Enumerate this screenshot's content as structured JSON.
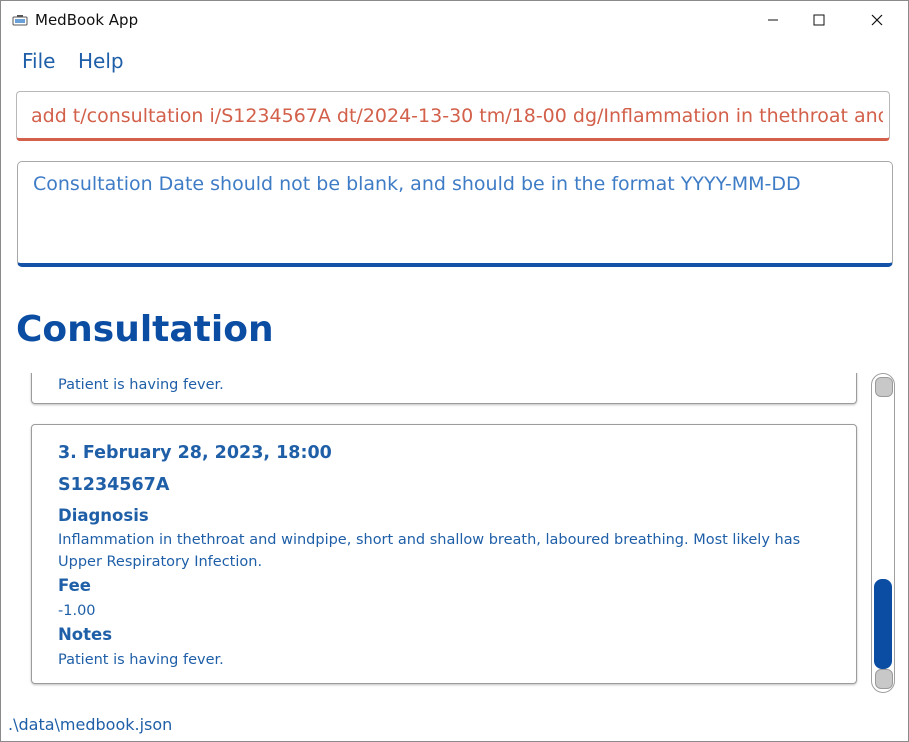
{
  "window": {
    "title": "MedBook App",
    "minimize_icon": "minimize-icon",
    "maximize_icon": "maximize-icon",
    "close_icon": "close-icon"
  },
  "menu": {
    "file": "File",
    "help": "Help"
  },
  "command": {
    "value": "add t/consultation i/S1234567A dt/2024-13-30 tm/18-00 dg/Inflammation in thethroat and windpipe"
  },
  "result": {
    "message": "Consultation Date should not be blank, and should be in the format YYYY-MM-DD"
  },
  "section": {
    "title": "Consultation"
  },
  "list": {
    "previous_card": {
      "notes_value": "Patient is having fever."
    },
    "current_card": {
      "header": "3.  February 28, 2023, 18:00",
      "patient_id": "S1234567A",
      "diagnosis_label": "Diagnosis",
      "diagnosis_value": "Inflammation in thethroat and windpipe, short and shallow breath, laboured breathing. Most likely has Upper Respiratory Infection.",
      "fee_label": "Fee",
      "fee_value": "-1.00",
      "notes_label": "Notes",
      "notes_value": "Patient is having fever."
    }
  },
  "status": {
    "file_path": ".\\data\\medbook.json"
  },
  "colors": {
    "accent": "#0b4da3",
    "text_blue": "#1f5fa8",
    "error": "#d2604a"
  }
}
